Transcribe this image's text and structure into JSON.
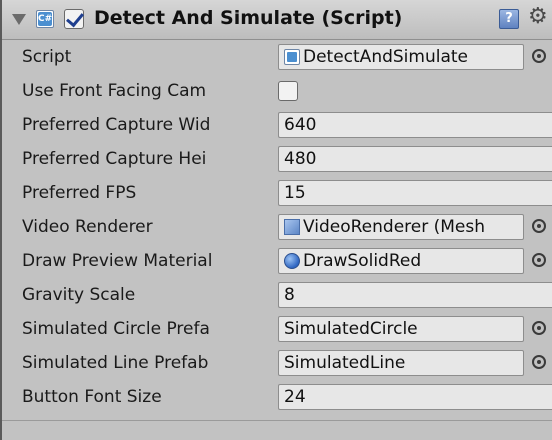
{
  "component": {
    "title": "Detect And Simulate (Script)",
    "enabled": true
  },
  "fields": {
    "script": {
      "label": "Script",
      "value": "DetectAndSimulate"
    },
    "use_front_camera": {
      "label": "Use Front Facing Cam",
      "value": false
    },
    "preferred_capture_width": {
      "label": "Preferred Capture Wid",
      "value": "640"
    },
    "preferred_capture_height": {
      "label": "Preferred Capture Hei",
      "value": "480"
    },
    "preferred_fps": {
      "label": "Preferred FPS",
      "value": "15"
    },
    "video_renderer": {
      "label": "Video Renderer",
      "value": "VideoRenderer (Mesh"
    },
    "draw_preview_material": {
      "label": "Draw Preview Material",
      "value": "DrawSolidRed"
    },
    "gravity_scale": {
      "label": "Gravity Scale",
      "value": "8"
    },
    "simulated_circle_prefab": {
      "label": "Simulated Circle Prefa",
      "value": "SimulatedCircle"
    },
    "simulated_line_prefab": {
      "label": "Simulated Line Prefab",
      "value": "SimulatedLine"
    },
    "button_font_size": {
      "label": "Button Font Size",
      "value": "24"
    }
  },
  "icons": {
    "header_fold": "fold-arrow-icon",
    "header_script": "script-icon",
    "help": "help-book-icon",
    "settings": "gear-icon",
    "object_picker": "object-picker-icon"
  }
}
